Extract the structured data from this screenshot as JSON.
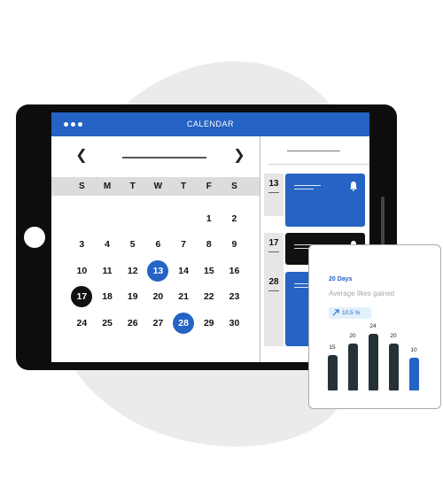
{
  "app": {
    "title": "CALENDAR"
  },
  "calendar": {
    "weekdays": [
      "S",
      "M",
      "T",
      "W",
      "T",
      "F",
      "S"
    ],
    "weeks": [
      [
        "",
        "",
        "",
        "",
        "",
        "1",
        "2"
      ],
      [
        "3",
        "4",
        "5",
        "6",
        "7",
        "8",
        "9"
      ],
      [
        "10",
        "11",
        "12",
        "13",
        "14",
        "15",
        "16"
      ],
      [
        "17",
        "18",
        "19",
        "20",
        "21",
        "22",
        "23"
      ],
      [
        "24",
        "25",
        "26",
        "27",
        "28",
        "29",
        "30"
      ]
    ],
    "selected_blue": [
      "13",
      "28"
    ],
    "selected_black": [
      "17"
    ]
  },
  "events": [
    {
      "date": "13",
      "color": "#2563c4",
      "icon": "bell-icon"
    },
    {
      "date": "17",
      "color": "#111111",
      "icon": "bell-icon"
    },
    {
      "date": "28",
      "color": "#2563c4",
      "icon": ""
    }
  ],
  "stats": {
    "period": "20 Days",
    "subtitle": "Average likes gained",
    "change": "10,5 %",
    "change_icon": "trend-up-icon",
    "accent": "#2563c4",
    "muted": "#263238",
    "chart_data": {
      "type": "bar",
      "values": [
        15,
        20,
        24,
        20,
        10
      ],
      "highlight_index": 4
    }
  },
  "colors": {
    "primary": "#2563c4",
    "dark": "#0d0d0d",
    "blob": "#ebebeb"
  }
}
